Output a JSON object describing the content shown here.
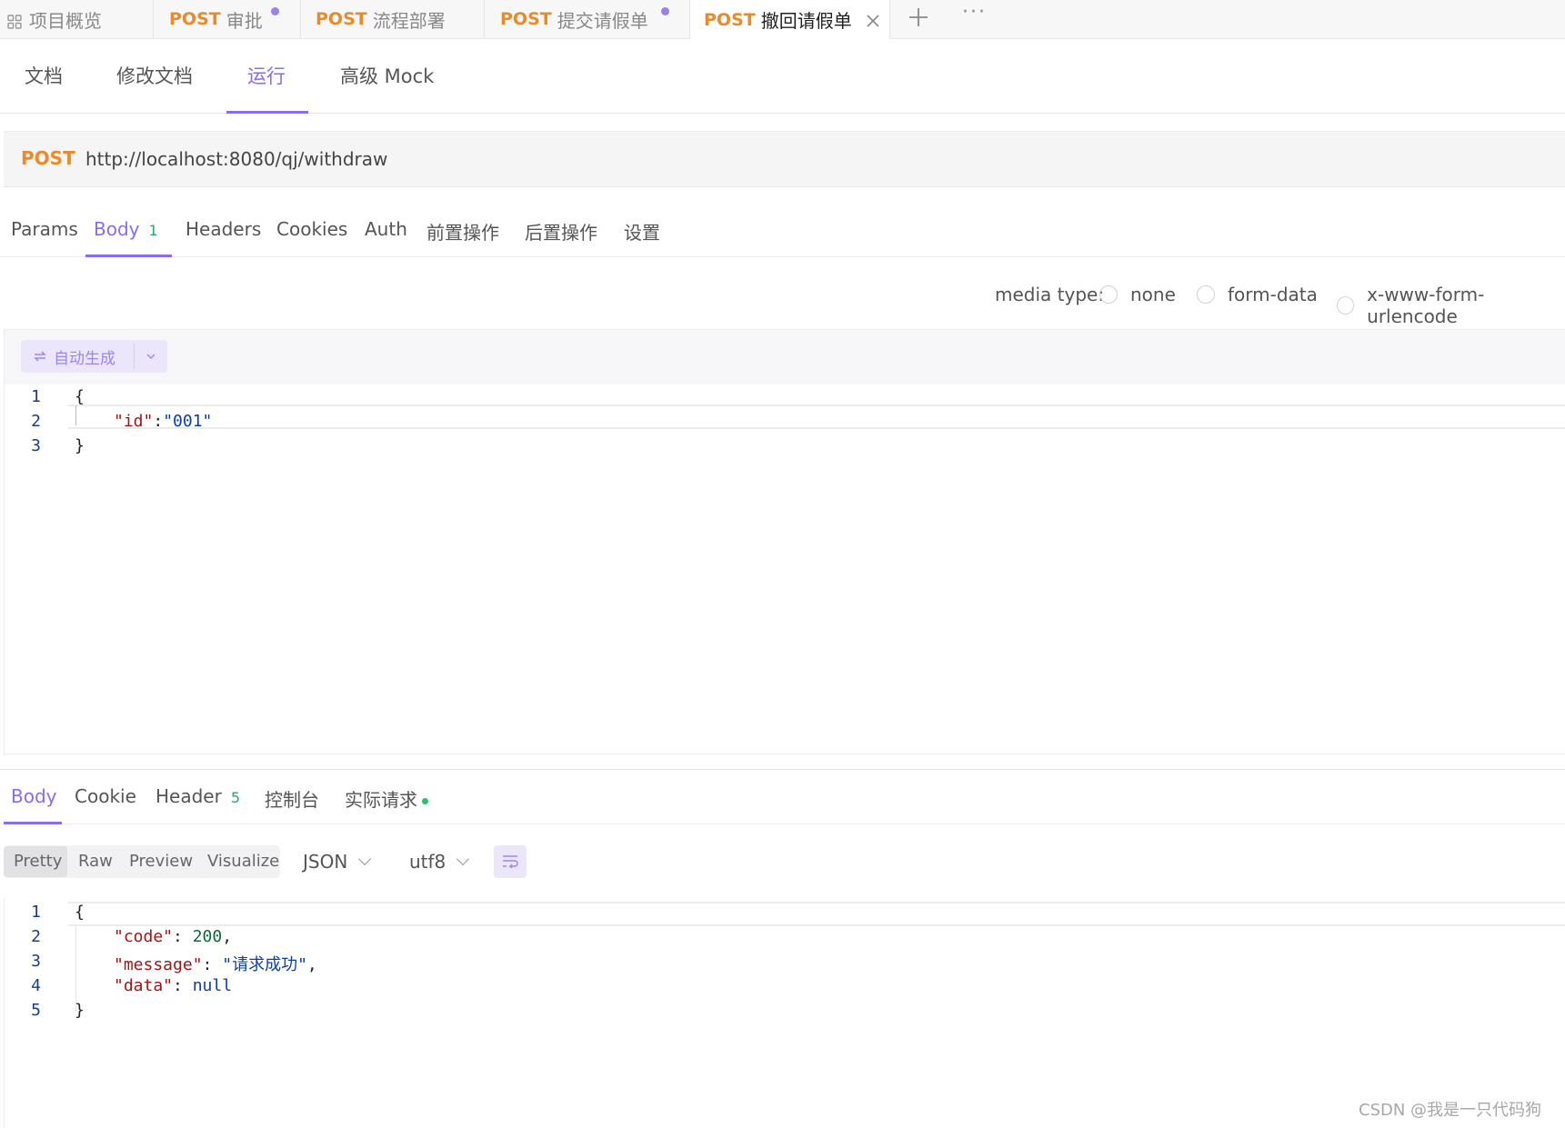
{
  "top_tabs": {
    "overview": "项目概览",
    "tab1_method": "POST",
    "tab1_name": "审批",
    "tab2_method": "POST",
    "tab2_name": "流程部署",
    "tab3_method": "POST",
    "tab3_name": "提交请假单",
    "tab4_method": "POST",
    "tab4_name": "撤回请假单",
    "add": "+",
    "more": "···"
  },
  "sub_tabs": {
    "doc": "文档",
    "edit": "修改文档",
    "run": "运行",
    "mock": "高级 Mock"
  },
  "request": {
    "method": "POST",
    "url": "http://localhost:8080/qj/withdraw"
  },
  "request_tabs": {
    "params": "Params",
    "body": "Body",
    "body_count": "1",
    "headers": "Headers",
    "cookies": "Cookies",
    "auth": "Auth",
    "pre": "前置操作",
    "post": "后置操作",
    "settings": "设置"
  },
  "media": {
    "label": "media type:",
    "none": "none",
    "form": "form-data",
    "urlencoded": "x-www-form-urlencode"
  },
  "auto_generate": "自动生成",
  "request_body": {
    "line_numbers": [
      "1",
      "2",
      "3"
    ],
    "open": "{",
    "key": "\"id\"",
    "colon": ":",
    "value": "\"001\"",
    "close": "}"
  },
  "response_tabs": {
    "body": "Body",
    "cookie": "Cookie",
    "header": "Header",
    "header_count": "5",
    "console": "控制台",
    "actual": "实际请求"
  },
  "view_modes": {
    "pretty": "Pretty",
    "raw": "Raw",
    "preview": "Preview",
    "visualize": "Visualize"
  },
  "format": "JSON",
  "encoding": "utf8",
  "response_body": {
    "line_numbers": [
      "1",
      "2",
      "3",
      "4",
      "5"
    ],
    "open": "{",
    "code_key": "\"code\"",
    "code_val": "200",
    "msg_key": "\"message\"",
    "msg_val": "\"请求成功\"",
    "data_key": "\"data\"",
    "data_val": "null",
    "close": "}"
  },
  "watermark": "CSDN @我是一只代码狗"
}
